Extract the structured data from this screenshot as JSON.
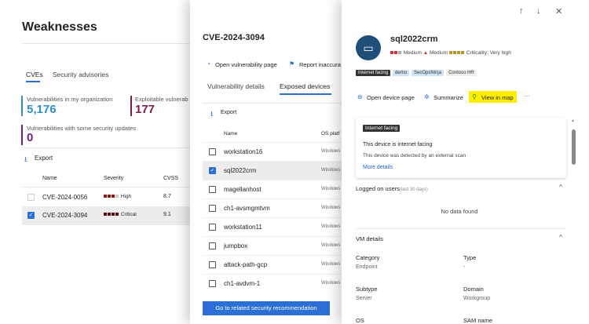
{
  "page": {
    "title": "Weaknesses",
    "tabs": [
      "CVEs",
      "Security advisories"
    ],
    "stats": [
      {
        "label": "Vulnerabilities in my organization",
        "value": "5,176",
        "color": "#2e8fc9"
      },
      {
        "label": "Exploitable vulnerab",
        "value": "177",
        "color": "#7a1d4f"
      },
      {
        "label": "Vulnerabilities with some security updates",
        "value": "0",
        "color": "#6b1e8c"
      }
    ],
    "export": "Export",
    "columns": [
      "Name",
      "Severity",
      "CVSS"
    ],
    "rows": [
      {
        "name": "CVE-2024-0056",
        "severity": "High",
        "cvss": "8.7"
      },
      {
        "name": "CVE-2024-3094",
        "severity": "Critical",
        "cvss": "9.1"
      }
    ]
  },
  "cve_panel": {
    "title": "CVE-2024-3094",
    "actions": [
      "Open vulnerability page",
      "Report inaccura"
    ],
    "tabs": [
      "Vulnerability details",
      "Exposed devices"
    ],
    "export": "Export",
    "columns": [
      "Name",
      "OS platf"
    ],
    "devices": [
      {
        "name": "workstation16",
        "os": "Windows"
      },
      {
        "name": "sql2022crm",
        "os": "Windows"
      },
      {
        "name": "magellanhost",
        "os": "Windows"
      },
      {
        "name": "ch1-avsmgmtvm",
        "os": "Windows"
      },
      {
        "name": "workstation11",
        "os": "Windows"
      },
      {
        "name": "jumpbox",
        "os": "Windows"
      },
      {
        "name": "attack-path-gcp",
        "os": "Windows"
      },
      {
        "name": "ch1-avdvm-1",
        "os": "Windows"
      }
    ],
    "button": "Go to related security recommendation"
  },
  "device_panel": {
    "name": "sql2022crm",
    "risk": "Medium",
    "exposure": "Medium",
    "criticality": "Criticality: Very high",
    "tags": [
      "Internet facing",
      "demo",
      "SecOpsNinja",
      "Contoso HR"
    ],
    "actions": [
      "Open device page",
      "Summarize",
      "View in map"
    ],
    "card": {
      "badge": "Internet facing",
      "title": "This device is internet facing",
      "desc": "This device was detected by an external scan",
      "link": "More details"
    },
    "logged_on": {
      "title": "Logged on users",
      "sub": "(last 30 days)",
      "empty": "No data found"
    },
    "vm": {
      "title": "VM details",
      "fields": [
        {
          "label": "Category",
          "value": "Endpoint"
        },
        {
          "label": "Type",
          "value": "-"
        },
        {
          "label": "Subtype",
          "value": "Server"
        },
        {
          "label": "Domain",
          "value": "Workgroup"
        },
        {
          "label": "OS",
          "value": ""
        },
        {
          "label": "SAM name",
          "value": ""
        }
      ]
    }
  }
}
